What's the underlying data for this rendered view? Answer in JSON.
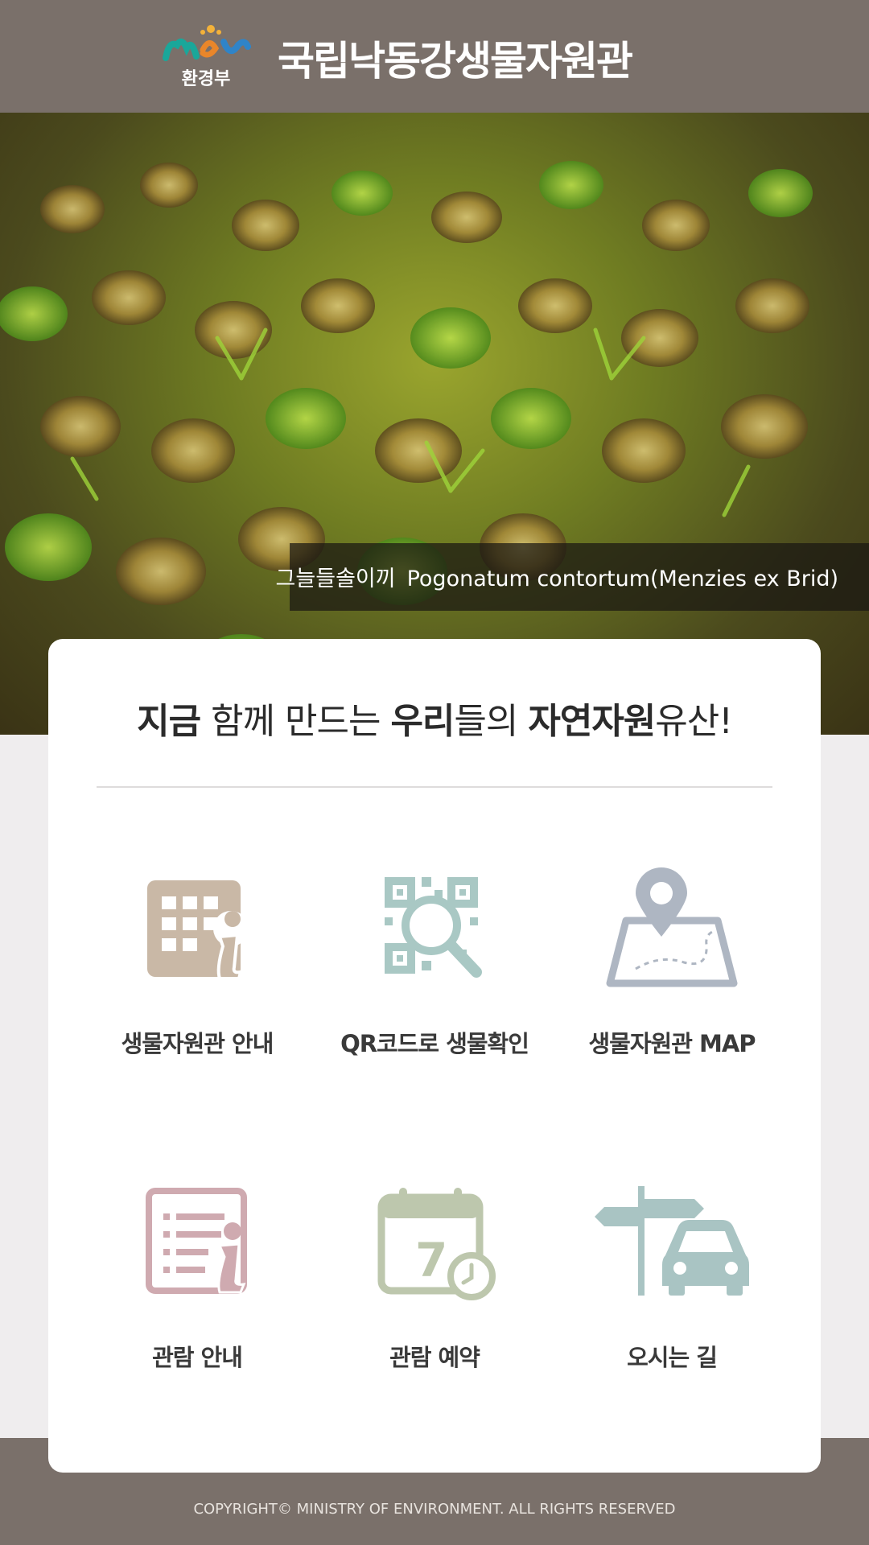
{
  "header": {
    "logo_text": "환경부",
    "title": "국립낙동강생물자원관",
    "background_color": "#7a706a"
  },
  "hero": {
    "caption_korean": "그늘들솔이끼",
    "caption_scientific": "Pogonatum contortum(Menzies ex Brid)"
  },
  "card": {
    "tagline_parts": [
      "지금",
      " 함께 만드는 ",
      "우리",
      "들의 ",
      "자연자원",
      "유산!"
    ]
  },
  "menu": [
    {
      "label": "생물자원관 안내",
      "icon": "building-info-icon",
      "color": "#c9b8a6"
    },
    {
      "label": "QR코드로 생물확인",
      "icon": "qr-search-icon",
      "color": "#a9c8c4"
    },
    {
      "label": "생물자원관 MAP",
      "icon": "map-pin-icon",
      "color": "#aeb6c2"
    },
    {
      "label": "관람 안내",
      "icon": "document-info-icon",
      "color": "#cfaab0"
    },
    {
      "label": "관람 예약",
      "icon": "calendar-icon",
      "color": "#bdc7ad"
    },
    {
      "label": "오시는 길",
      "icon": "signpost-car-icon",
      "color": "#a9c4c3"
    }
  ],
  "footer": {
    "copyright": "COPYRIGHT© MINISTRY OF ENVIRONMENT. ALL RIGHTS RESERVED"
  }
}
